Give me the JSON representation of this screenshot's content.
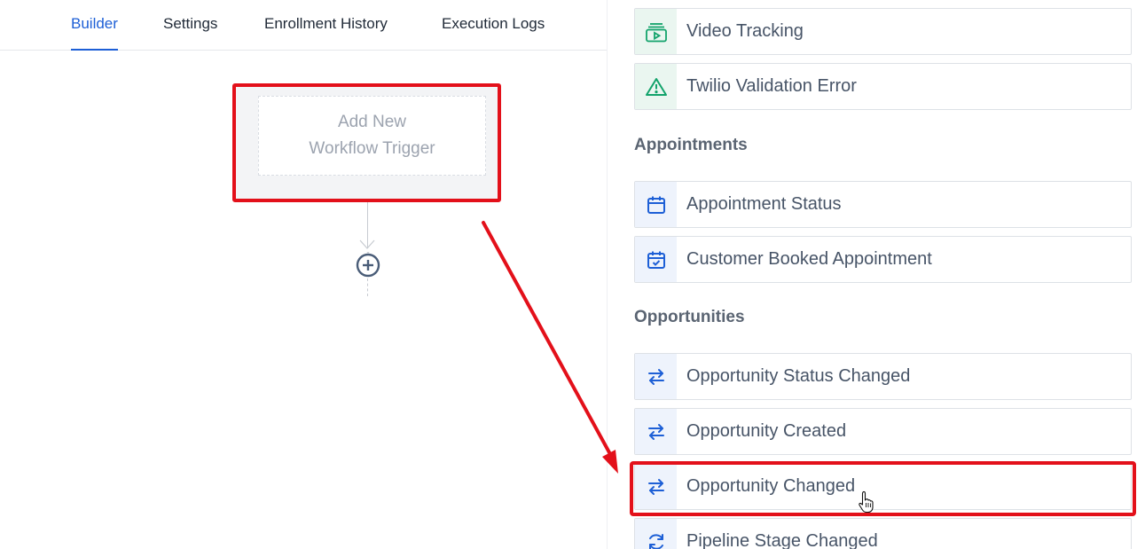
{
  "tabs": [
    {
      "label": "Builder",
      "active": true
    },
    {
      "label": "Settings",
      "active": false
    },
    {
      "label": "Enrollment History",
      "active": false
    },
    {
      "label": "Execution Logs",
      "active": false
    }
  ],
  "builder": {
    "trigger_line1": "Add New",
    "trigger_line2": "Workflow Trigger"
  },
  "panel": {
    "items_top": [
      {
        "label": "Video Tracking",
        "icon": "video-tracking-icon",
        "color": "#12a36b"
      },
      {
        "label": "Twilio Validation Error",
        "icon": "warning-triangle-icon",
        "color": "#12a36b"
      }
    ],
    "appointments": {
      "title": "Appointments",
      "items": [
        {
          "label": "Appointment Status",
          "icon": "calendar-icon",
          "color": "#1d5fd6"
        },
        {
          "label": "Customer Booked Appointment",
          "icon": "calendar-check-icon",
          "color": "#1d5fd6"
        }
      ]
    },
    "opportunities": {
      "title": "Opportunities",
      "items": [
        {
          "label": "Opportunity Status Changed",
          "icon": "swap-arrows-icon",
          "color": "#1d5fd6"
        },
        {
          "label": "Opportunity Created",
          "icon": "swap-arrows-icon",
          "color": "#1d5fd6"
        },
        {
          "label": "Opportunity Changed",
          "icon": "swap-arrows-icon",
          "color": "#1d5fd6"
        },
        {
          "label": "Pipeline Stage Changed",
          "icon": "refresh-icon",
          "color": "#1d5fd6"
        }
      ]
    }
  },
  "colors": {
    "accent": "#1d5fd6",
    "highlight": "#e3101a",
    "green": "#12a36b"
  }
}
